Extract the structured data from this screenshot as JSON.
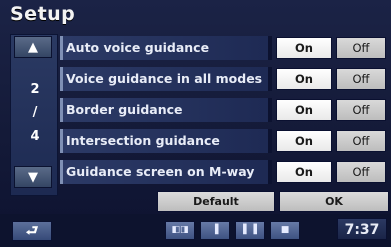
{
  "window": {
    "title": "Setup"
  },
  "navigation": {
    "scroll_up_icon": "up-arrow",
    "scroll_down_icon": "down-arrow",
    "page_current": "2",
    "page_separator": "/",
    "page_total": "4"
  },
  "settings": [
    {
      "label": "Auto voice guidance",
      "on_label": "On",
      "off_label": "Off",
      "selected": "on"
    },
    {
      "label": "Voice guidance in all modes",
      "on_label": "On",
      "off_label": "Off",
      "selected": "on"
    },
    {
      "label": "Border guidance",
      "on_label": "On",
      "off_label": "Off",
      "selected": "on"
    },
    {
      "label": "Intersection guidance",
      "on_label": "On",
      "off_label": "Off",
      "selected": "on"
    },
    {
      "label": "Guidance screen on M-way",
      "on_label": "On",
      "off_label": "Off",
      "selected": "on"
    }
  ],
  "actions": {
    "default_label": "Default",
    "ok_label": "OK"
  },
  "bottom_bar": {
    "back_icon": "return-arrow",
    "view_icons": [
      "split-view",
      "map-view",
      "list-view",
      "screen-off"
    ],
    "clock": "7:37"
  },
  "colors": {
    "background": "#141a38",
    "row_label": "#1e2a54",
    "button_selected": "#ffffff",
    "button_unselected": "#bdbdbd",
    "accent": "#7f90b5"
  }
}
